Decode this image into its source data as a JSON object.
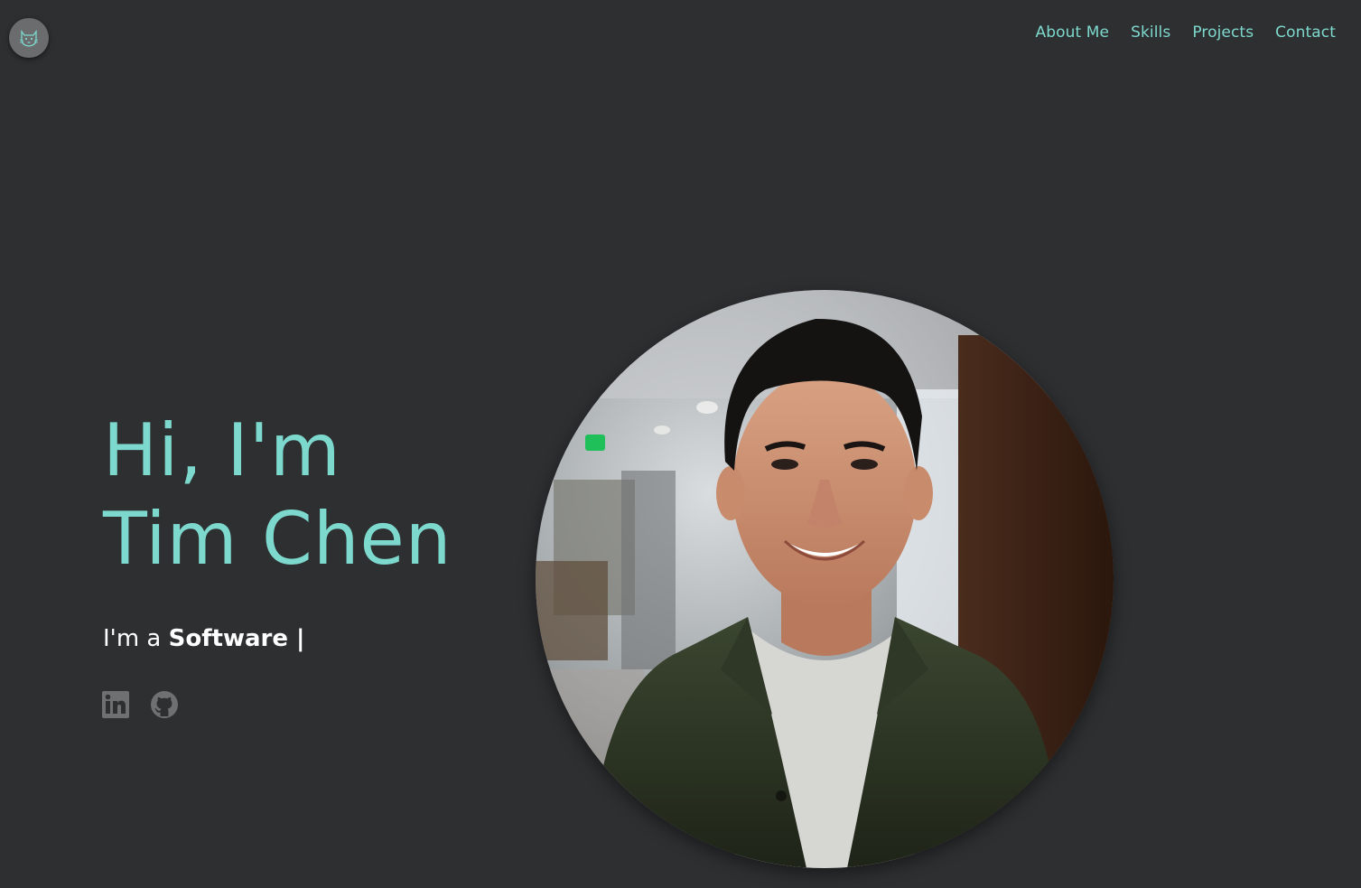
{
  "logo": {
    "icon": "cat-face-icon"
  },
  "nav": {
    "items": [
      {
        "label": "About Me"
      },
      {
        "label": "Skills"
      },
      {
        "label": "Projects"
      },
      {
        "label": "Contact"
      }
    ]
  },
  "hero": {
    "greeting": "Hi, I'm",
    "name": "Tim Chen",
    "tagline_prefix": "I'm a ",
    "tagline_role": "Software",
    "cursor": " |"
  },
  "socials": [
    {
      "icon": "linkedin-icon"
    },
    {
      "icon": "github-icon"
    }
  ],
  "colors": {
    "background": "#2e2f31",
    "accent": "#7dd9cd",
    "icon_gray": "#6f7072"
  }
}
